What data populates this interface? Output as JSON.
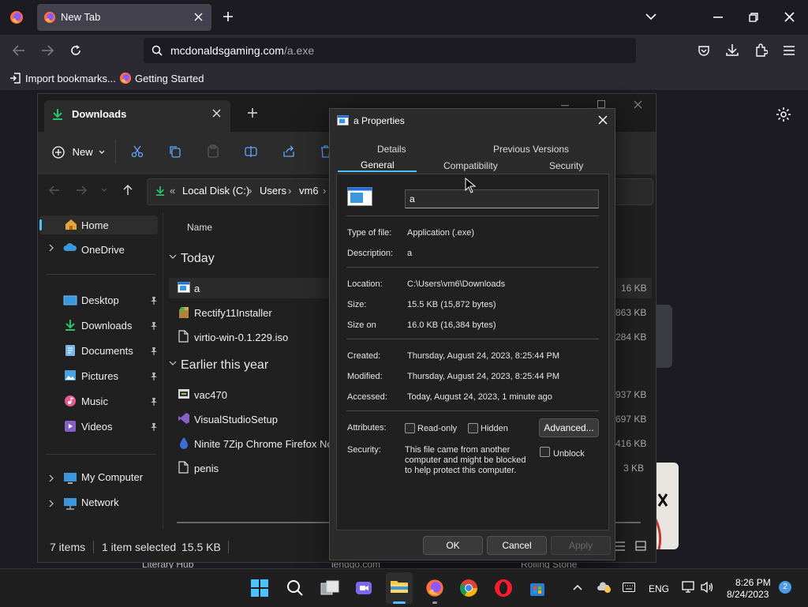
{
  "browser": {
    "tab_title": "New Tab",
    "url_host": "mcdonaldsgaming.com",
    "url_path": "/a.exe",
    "bookmarks": [
      "Import bookmarks...",
      "Getting Started"
    ]
  },
  "explorer": {
    "tab_title": "Downloads",
    "new_label": "New",
    "breadcrumb": [
      "Local Disk (C:)",
      "Users",
      "vm6"
    ],
    "column_name": "Name",
    "nav": {
      "home": "Home",
      "onedrive": "OneDrive",
      "desktop": "Desktop",
      "downloads": "Downloads",
      "documents": "Documents",
      "pictures": "Pictures",
      "music": "Music",
      "videos": "Videos",
      "my_computer": "My Computer",
      "network": "Network"
    },
    "groups": {
      "today": "Today",
      "earlier": "Earlier this year"
    },
    "files_today": [
      {
        "name": "a",
        "size": "16 KB"
      },
      {
        "name": "Rectify11Installer",
        "size": "863 KB"
      },
      {
        "name": "virtio-win-0.1.229.iso",
        "size": "284 KB"
      }
    ],
    "files_earlier": [
      {
        "name": "vac470",
        "size": "937 KB"
      },
      {
        "name": "VisualStudioSetup",
        "size": "697 KB"
      },
      {
        "name": "Ninite 7Zip Chrome Firefox Note",
        "size": "416 KB"
      },
      {
        "name": "penis",
        "size": "3 KB"
      }
    ],
    "status": {
      "items": "7 items",
      "selected": "1 item selected",
      "size": "15.5 KB"
    }
  },
  "background_labels": [
    "Literary Hub",
    "lendgo.com",
    "Rolling Stone"
  ],
  "props": {
    "title": "a Properties",
    "tabs_top": [
      "Details",
      "Previous Versions"
    ],
    "tabs_bottom": [
      "General",
      "Compatibility",
      "Security"
    ],
    "filename": "a",
    "type_label": "Type of file:",
    "type_value": "Application (.exe)",
    "desc_label": "Description:",
    "desc_value": "a",
    "location_label": "Location:",
    "location_value": "C:\\Users\\vm6\\Downloads",
    "size_label": "Size:",
    "size_value": "15.5 KB (15,872 bytes)",
    "sizeon_label": "Size on",
    "sizeon_value": "16.0 KB (16,384 bytes)",
    "created_label": "Created:",
    "created_value": "Thursday, August 24, 2023, 8:25:44 PM",
    "modified_label": "Modified:",
    "modified_value": "Thursday, August 24, 2023, 8:25:44 PM",
    "accessed_label": "Accessed:",
    "accessed_value": "Today, August 24, 2023, 1 minute ago",
    "attributes_label": "Attributes:",
    "readonly": "Read-only",
    "hidden": "Hidden",
    "advanced": "Advanced...",
    "security_label": "Security:",
    "security_text": [
      "This file came from another",
      "computer and might be blocked",
      "to help protect this computer."
    ],
    "unblock": "Unblock",
    "ok": "OK",
    "cancel": "Cancel",
    "apply": "Apply"
  },
  "taskbar": {
    "lang": "ENG",
    "time": "8:26 PM",
    "date": "8/24/2023",
    "notifications": "2"
  }
}
